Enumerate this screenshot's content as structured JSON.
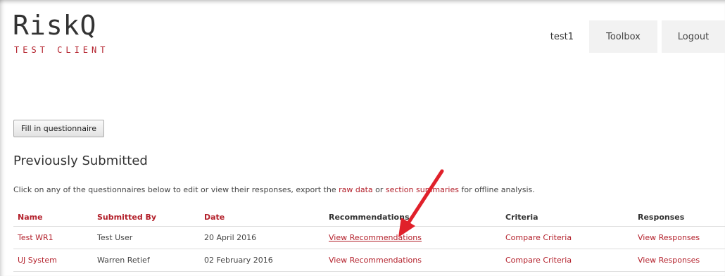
{
  "logo": {
    "title": "RiskQ",
    "subtitle": "TEST CLIENT"
  },
  "header": {
    "username": "test1",
    "toolbox_label": "Toolbox",
    "logout_label": "Logout"
  },
  "actions": {
    "fill_label": "Fill in questionnaire"
  },
  "section": {
    "title": "Previously Submitted"
  },
  "intro": {
    "part1": "Click on any of the questionnaires below to edit or view their responses, export the ",
    "link1": "raw data",
    "part2": " or ",
    "link2": "section summaries",
    "part3": " for offline analysis."
  },
  "table": {
    "headers": [
      "Name",
      "Submitted By",
      "Date",
      "Recommendations",
      "Criteria",
      "Responses"
    ],
    "rows": [
      {
        "name": "Test WR1",
        "submitted_by": "Test User",
        "date": "20 April 2016",
        "recommendations": "View Recommendations",
        "criteria": "Compare Criteria",
        "responses": "View Responses"
      },
      {
        "name": "UJ System",
        "submitted_by": "Warren Retief",
        "date": "02 February 2016",
        "recommendations": "View Recommendations",
        "criteria": "Compare Criteria",
        "responses": "View Responses"
      }
    ]
  },
  "colors": {
    "accent": "#b3202b",
    "arrow": "#e0202a"
  }
}
